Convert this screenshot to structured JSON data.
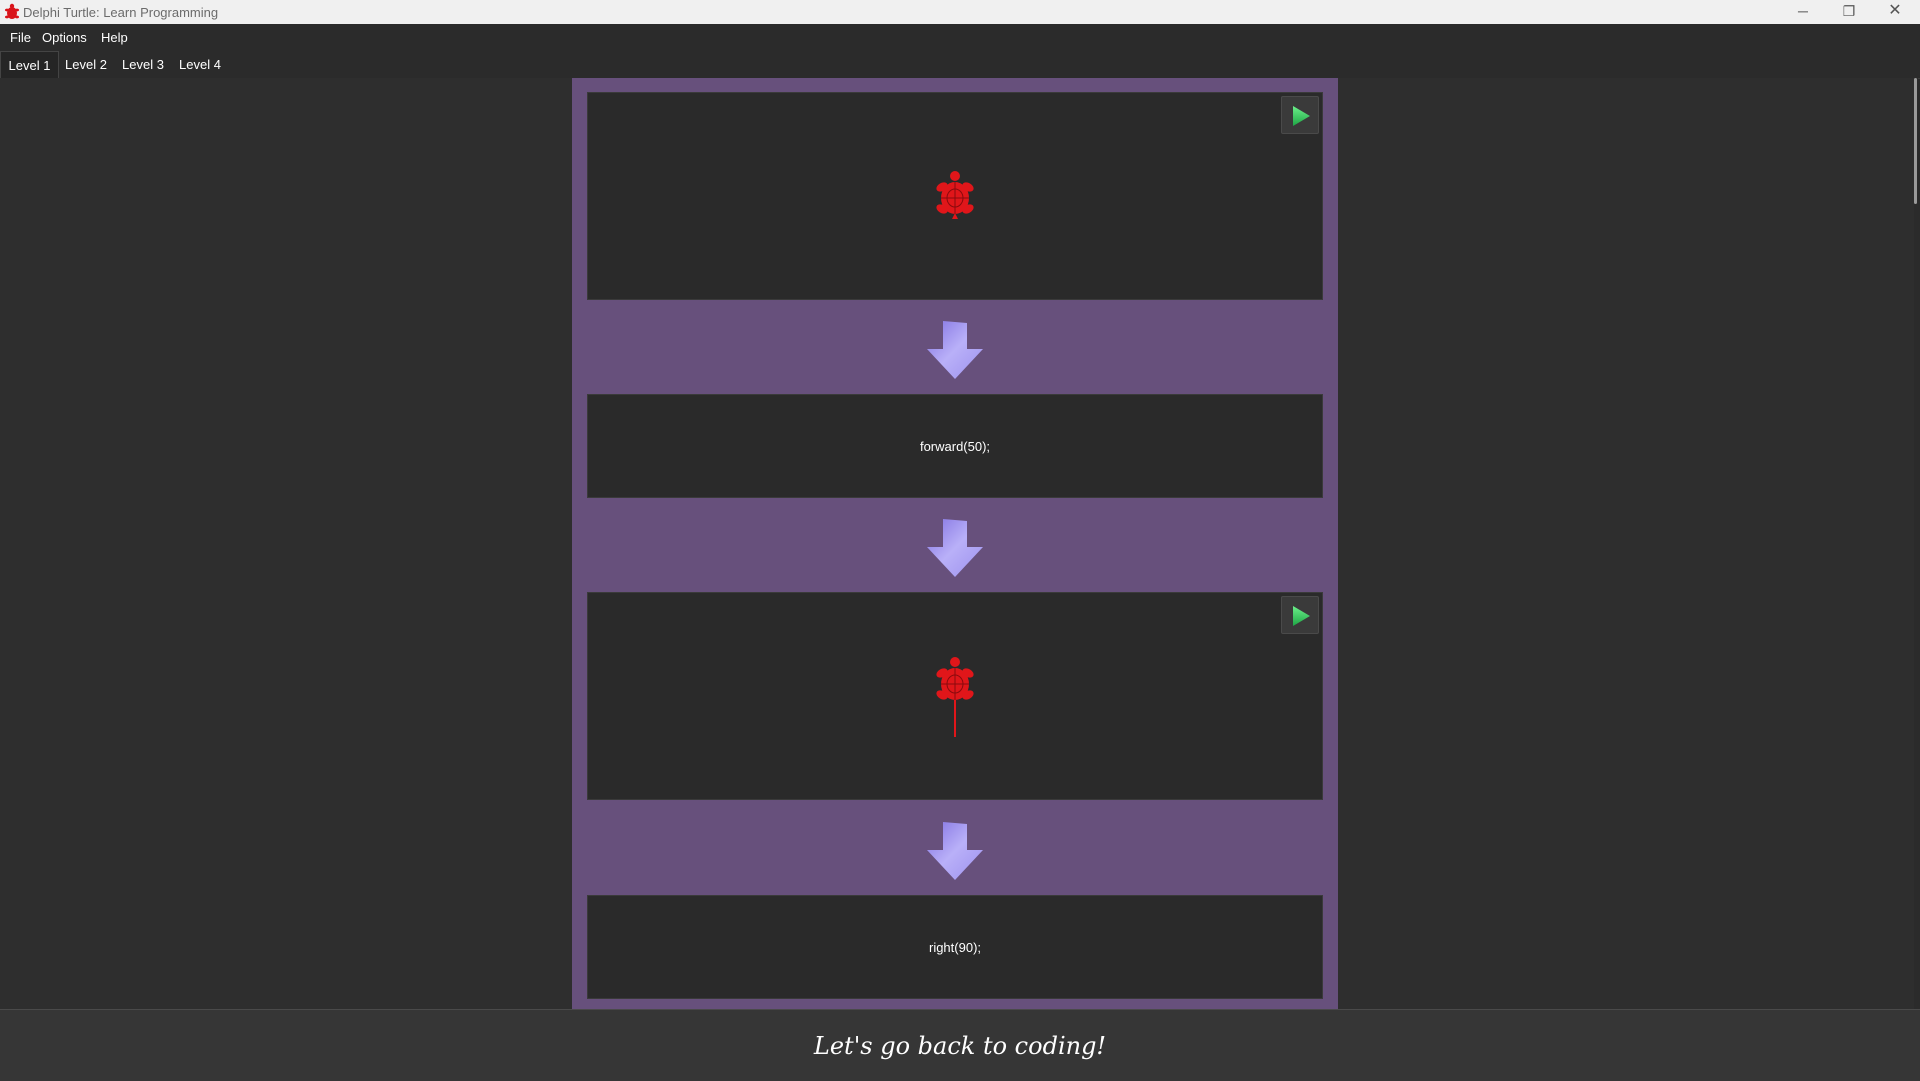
{
  "window": {
    "title": "Delphi Turtle: Learn Programming",
    "minimize_glyph": "─",
    "maximize_glyph": "❐",
    "close_glyph": "✕"
  },
  "menu": {
    "items": [
      "File",
      "Options",
      "Help"
    ]
  },
  "tabs": {
    "items": [
      "Level 1",
      "Level 2",
      "Level 3",
      "Level 4"
    ],
    "active": "Level 1"
  },
  "steps": [
    {
      "type": "canvas",
      "turtle_heading": "up",
      "has_trail": false,
      "play_icon": "play-icon"
    },
    {
      "type": "code",
      "text": "forward(50);"
    },
    {
      "type": "canvas",
      "turtle_heading": "up",
      "has_trail": true,
      "play_icon": "play-icon"
    },
    {
      "type": "code",
      "text": "right(90);"
    }
  ],
  "footer": {
    "message": "Let's go back to coding!"
  },
  "colors": {
    "column_bg": "#67507c",
    "turtle": "#e0161a",
    "play": "#33c75a",
    "arrow": "#a79bf2"
  }
}
